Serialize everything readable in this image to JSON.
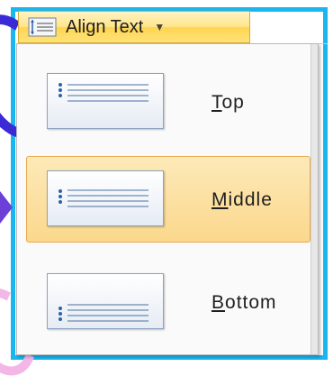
{
  "button": {
    "label": "Align Text",
    "icon": "align-text-icon",
    "arrow": "dropdown-arrow-icon"
  },
  "menu": {
    "items": [
      {
        "label": "Top",
        "icon": "align-top-icon",
        "selected": false
      },
      {
        "label": "Middle",
        "icon": "align-middle-icon",
        "selected": true
      },
      {
        "label": "Bottom",
        "icon": "align-bottom-icon",
        "selected": false
      }
    ]
  },
  "colors": {
    "frame": "#19b6f0",
    "highlight": "#fbd88c",
    "highlight_border": "#e8a94e"
  }
}
